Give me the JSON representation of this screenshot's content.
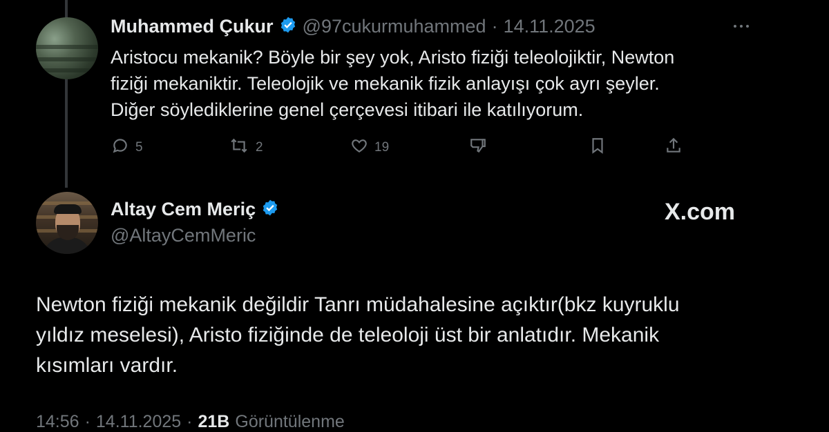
{
  "reply": {
    "author_name": "Muhammed Çukur",
    "handle": "@97cukurmuhammed",
    "separator": "·",
    "date": "14.11.2025",
    "text_lines": [
      "Aristocu mekanik? Böyle bir şey yok, Aristo fiziği teleolojiktir, Newton",
      "fiziği mekaniktir. Teleolojik ve mekanik fizik anlayışı çok ayrı şeyler.",
      "Diğer söylediklerine genel çerçevesi itibari ile katılıyorum."
    ],
    "actions": {
      "reply_count": "5",
      "repost_count": "2",
      "like_count": "19"
    }
  },
  "main": {
    "author_name": "Altay Cem Meriç",
    "handle": "@AltayCemMeric",
    "watermark": "X.com",
    "text_lines": [
      "Newton fiziği mekanik değildir Tanrı müdahalesine açıktır(bkz kuyruklu",
      "yıldız meselesi), Aristo fiziğinde de teleoloji üst bir anlatıdır. Mekanik",
      "kısımları vardır."
    ],
    "time": "14:56",
    "sep1": "·",
    "date": "14.11.2025",
    "sep2": "·",
    "views_count": "21B",
    "views_label": "Görüntülenme"
  },
  "colors": {
    "background": "#000000",
    "text": "#e7e9ea",
    "muted": "#71767b",
    "verified": "#1d9bf0"
  }
}
